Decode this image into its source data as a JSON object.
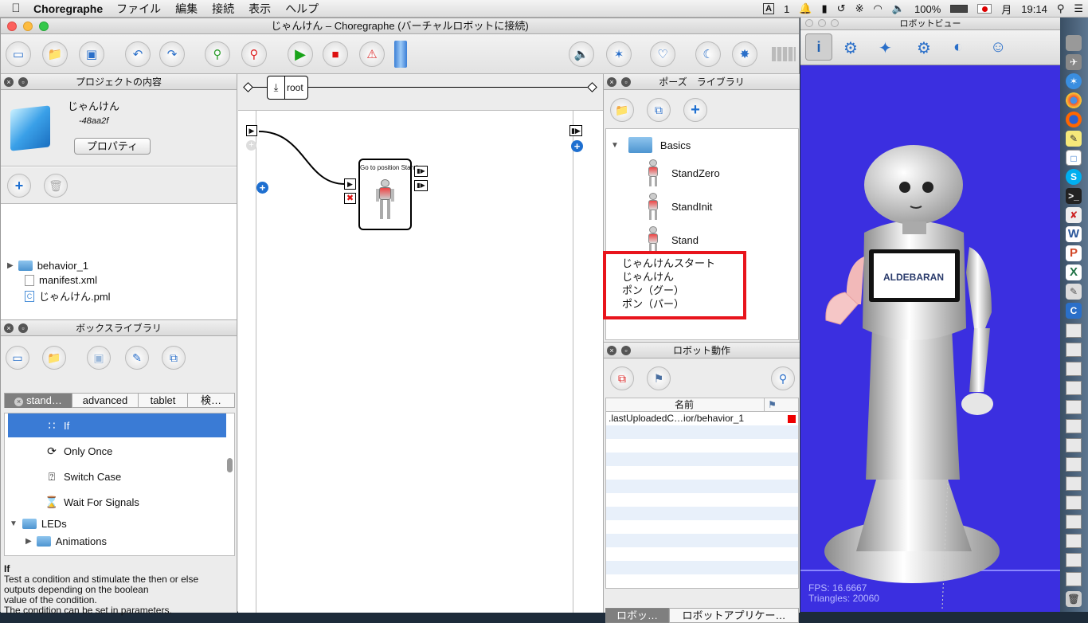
{
  "menubar": {
    "app": "Choregraphe",
    "items": [
      "ファイル",
      "編集",
      "接続",
      "表示",
      "ヘルプ"
    ],
    "status": {
      "input": "A",
      "count": "1",
      "battery": "100%",
      "day": "月",
      "time": "19:14"
    }
  },
  "window": {
    "title": "じゃんけん – Choregraphe (バーチャルロボットに接続)"
  },
  "project_panel": {
    "title": "プロジェクトの内容",
    "name": "じゃんけん",
    "id": "-48aa2f",
    "properties_button": "プロパティ",
    "files": [
      "behavior_1",
      "manifest.xml",
      "じゃんけん.pml"
    ]
  },
  "box_library": {
    "title": "ボックスライブラリ",
    "tabs": [
      "stand…",
      "advanced",
      "tablet",
      "検…"
    ],
    "items": [
      "If",
      "Only Once",
      "Switch Case",
      "Wait For Signals",
      "LEDs",
      "Animations"
    ],
    "description": {
      "title": "If",
      "lines": [
        "Test a condition and stimulate the then or else",
        "outputs depending on the boolean",
        "value of the condition.",
        "The condition can be set in parameters."
      ]
    }
  },
  "flow": {
    "breadcrumb": "root",
    "box_title": "Go to position Stand"
  },
  "pose_library": {
    "title": "ポーズ　ライブラリ",
    "folder": "Basics",
    "poses": [
      "StandZero",
      "StandInit",
      "Stand"
    ],
    "annotation": [
      "じゃんけんスタート",
      "じゃんけん",
      "ポン（グー）",
      "ポン（パー）"
    ],
    "annotation_color": "#e8141c"
  },
  "robot_actions": {
    "title": "ロボット動作",
    "column_name": "名前",
    "row": ".lastUploadedC…ior/behavior_1",
    "tabs": [
      "ロボッ…",
      "ロボットアプリケー…"
    ]
  },
  "robot_view": {
    "title": "ロボットビュー",
    "brand": "ALDEBARAN",
    "fps": "FPS: 16.6667",
    "triangles": "Triangles: 20060",
    "background": "#3b2fe0"
  },
  "dock": {
    "labels": [
      "S",
      "W",
      "P",
      "X",
      "C"
    ]
  }
}
